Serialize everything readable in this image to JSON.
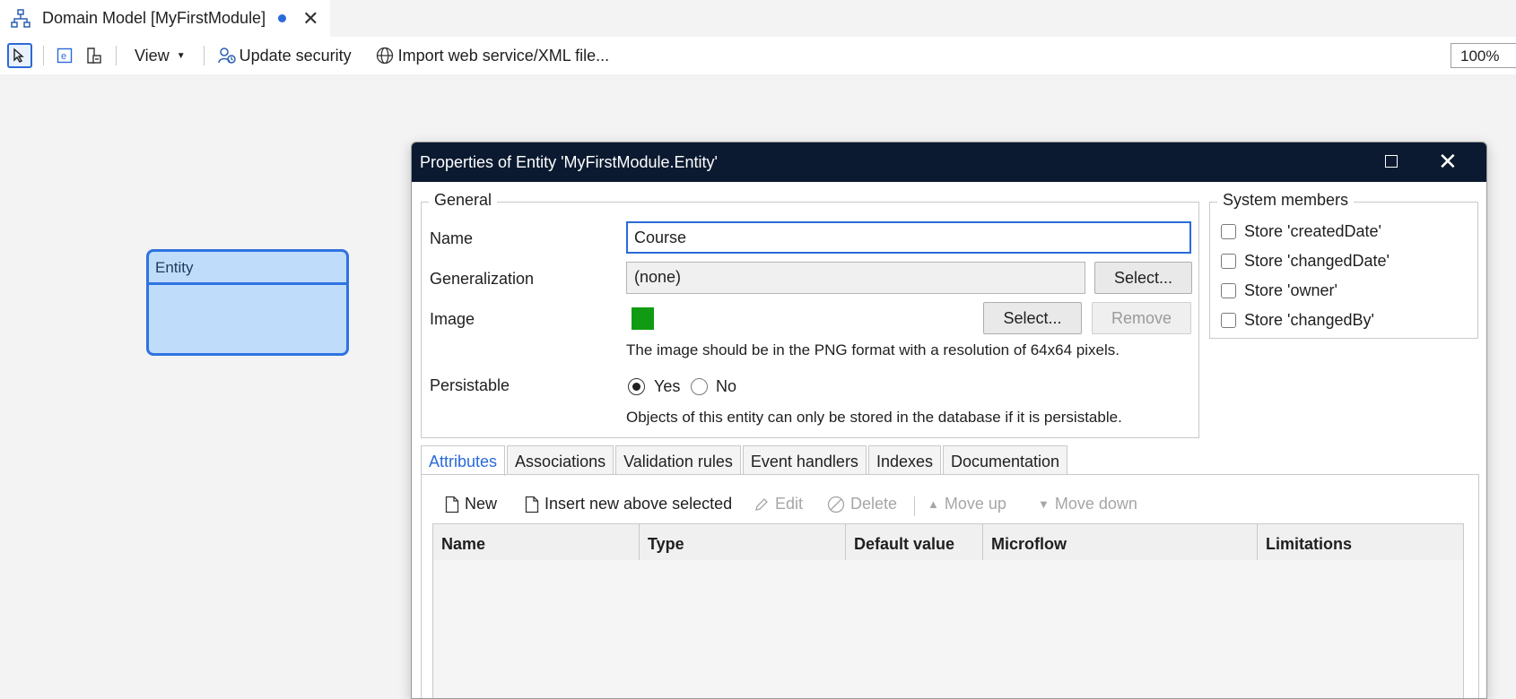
{
  "document_tab": {
    "title": "Domain Model [MyFirstModule]",
    "icon": "domain-model-icon"
  },
  "toolbar": {
    "view_label": "View",
    "update_security_label": "Update security",
    "import_label": "Import web service/XML file...",
    "zoom": "100%"
  },
  "canvas": {
    "entity_name": "Entity"
  },
  "dialog": {
    "title": "Properties of Entity 'MyFirstModule.Entity'",
    "general": {
      "legend": "General",
      "name_label": "Name",
      "name_value": "Course",
      "generalization_label": "Generalization",
      "generalization_value": "(none)",
      "select_label": "Select...",
      "image_label": "Image",
      "image_color": "#119b12",
      "image_select_label": "Select...",
      "image_remove_label": "Remove",
      "image_hint": "The image should be in the PNG format with a resolution of 64x64 pixels.",
      "persistable_label": "Persistable",
      "yes_label": "Yes",
      "no_label": "No",
      "persistable_hint": "Objects of this entity can only be stored in the database if it is persistable."
    },
    "system_members": {
      "legend": "System members",
      "items": [
        "Store 'createdDate'",
        "Store 'changedDate'",
        "Store 'owner'",
        "Store 'changedBy'"
      ]
    },
    "tabs": [
      "Attributes",
      "Associations",
      "Validation rules",
      "Event handlers",
      "Indexes",
      "Documentation"
    ],
    "actions": {
      "new": "New",
      "insert": "Insert new above selected",
      "edit": "Edit",
      "delete": "Delete",
      "move_up": "Move up",
      "move_down": "Move down"
    },
    "columns": [
      "Name",
      "Type",
      "Default value",
      "Microflow",
      "Limitations"
    ]
  },
  "accent_color": "#2b6ad8"
}
